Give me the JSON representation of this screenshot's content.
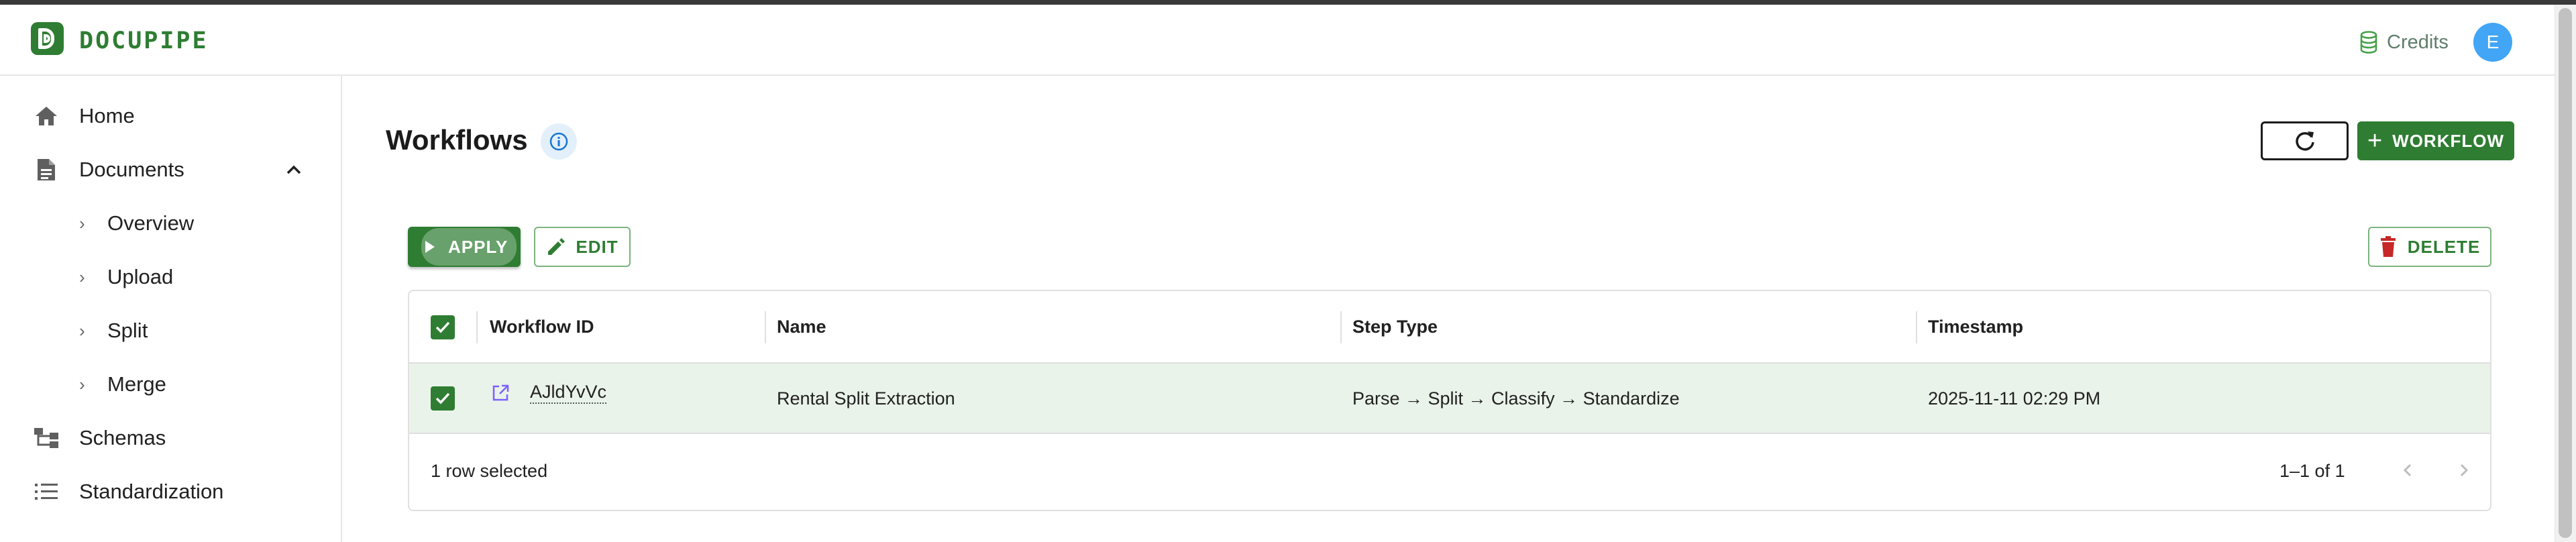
{
  "app": {
    "brand": "DOCUPIPE",
    "credits_label": "Credits",
    "user_initial": "E"
  },
  "sidebar": {
    "items": [
      {
        "label": "Home",
        "icon": "home-icon"
      },
      {
        "label": "Documents",
        "icon": "document-icon",
        "expanded": true
      },
      {
        "label": "Overview",
        "icon": "chevron-right-icon"
      },
      {
        "label": "Upload",
        "icon": "chevron-right-icon"
      },
      {
        "label": "Split",
        "icon": "chevron-right-icon"
      },
      {
        "label": "Merge",
        "icon": "chevron-right-icon"
      },
      {
        "label": "Schemas",
        "icon": "schema-tree-icon"
      },
      {
        "label": "Standardization",
        "icon": "list-icon"
      }
    ]
  },
  "page": {
    "title": "Workflows",
    "add_label": "WORKFLOW"
  },
  "toolbar": {
    "apply_label": "APPLY",
    "edit_label": "EDIT",
    "delete_label": "DELETE"
  },
  "table": {
    "columns": [
      "Workflow ID",
      "Name",
      "Step Type",
      "Timestamp"
    ],
    "rows": [
      {
        "selected": true,
        "workflow_id": "AJldYvVc",
        "name": "Rental Split Extraction",
        "step_type": "Parse → Split → Classify → Standardize",
        "timestamp": "2025-11-11 02:29 PM"
      }
    ],
    "selected_text": "1 row selected",
    "pagination_text": "1–1 of 1"
  },
  "colors": {
    "primary": "#2e7d32",
    "avatar": "#42a5f5",
    "info": "#1976d2",
    "delete_icon": "#c62828",
    "link_icon": "#7b61ff",
    "selected_row": "#eaf3ea"
  }
}
